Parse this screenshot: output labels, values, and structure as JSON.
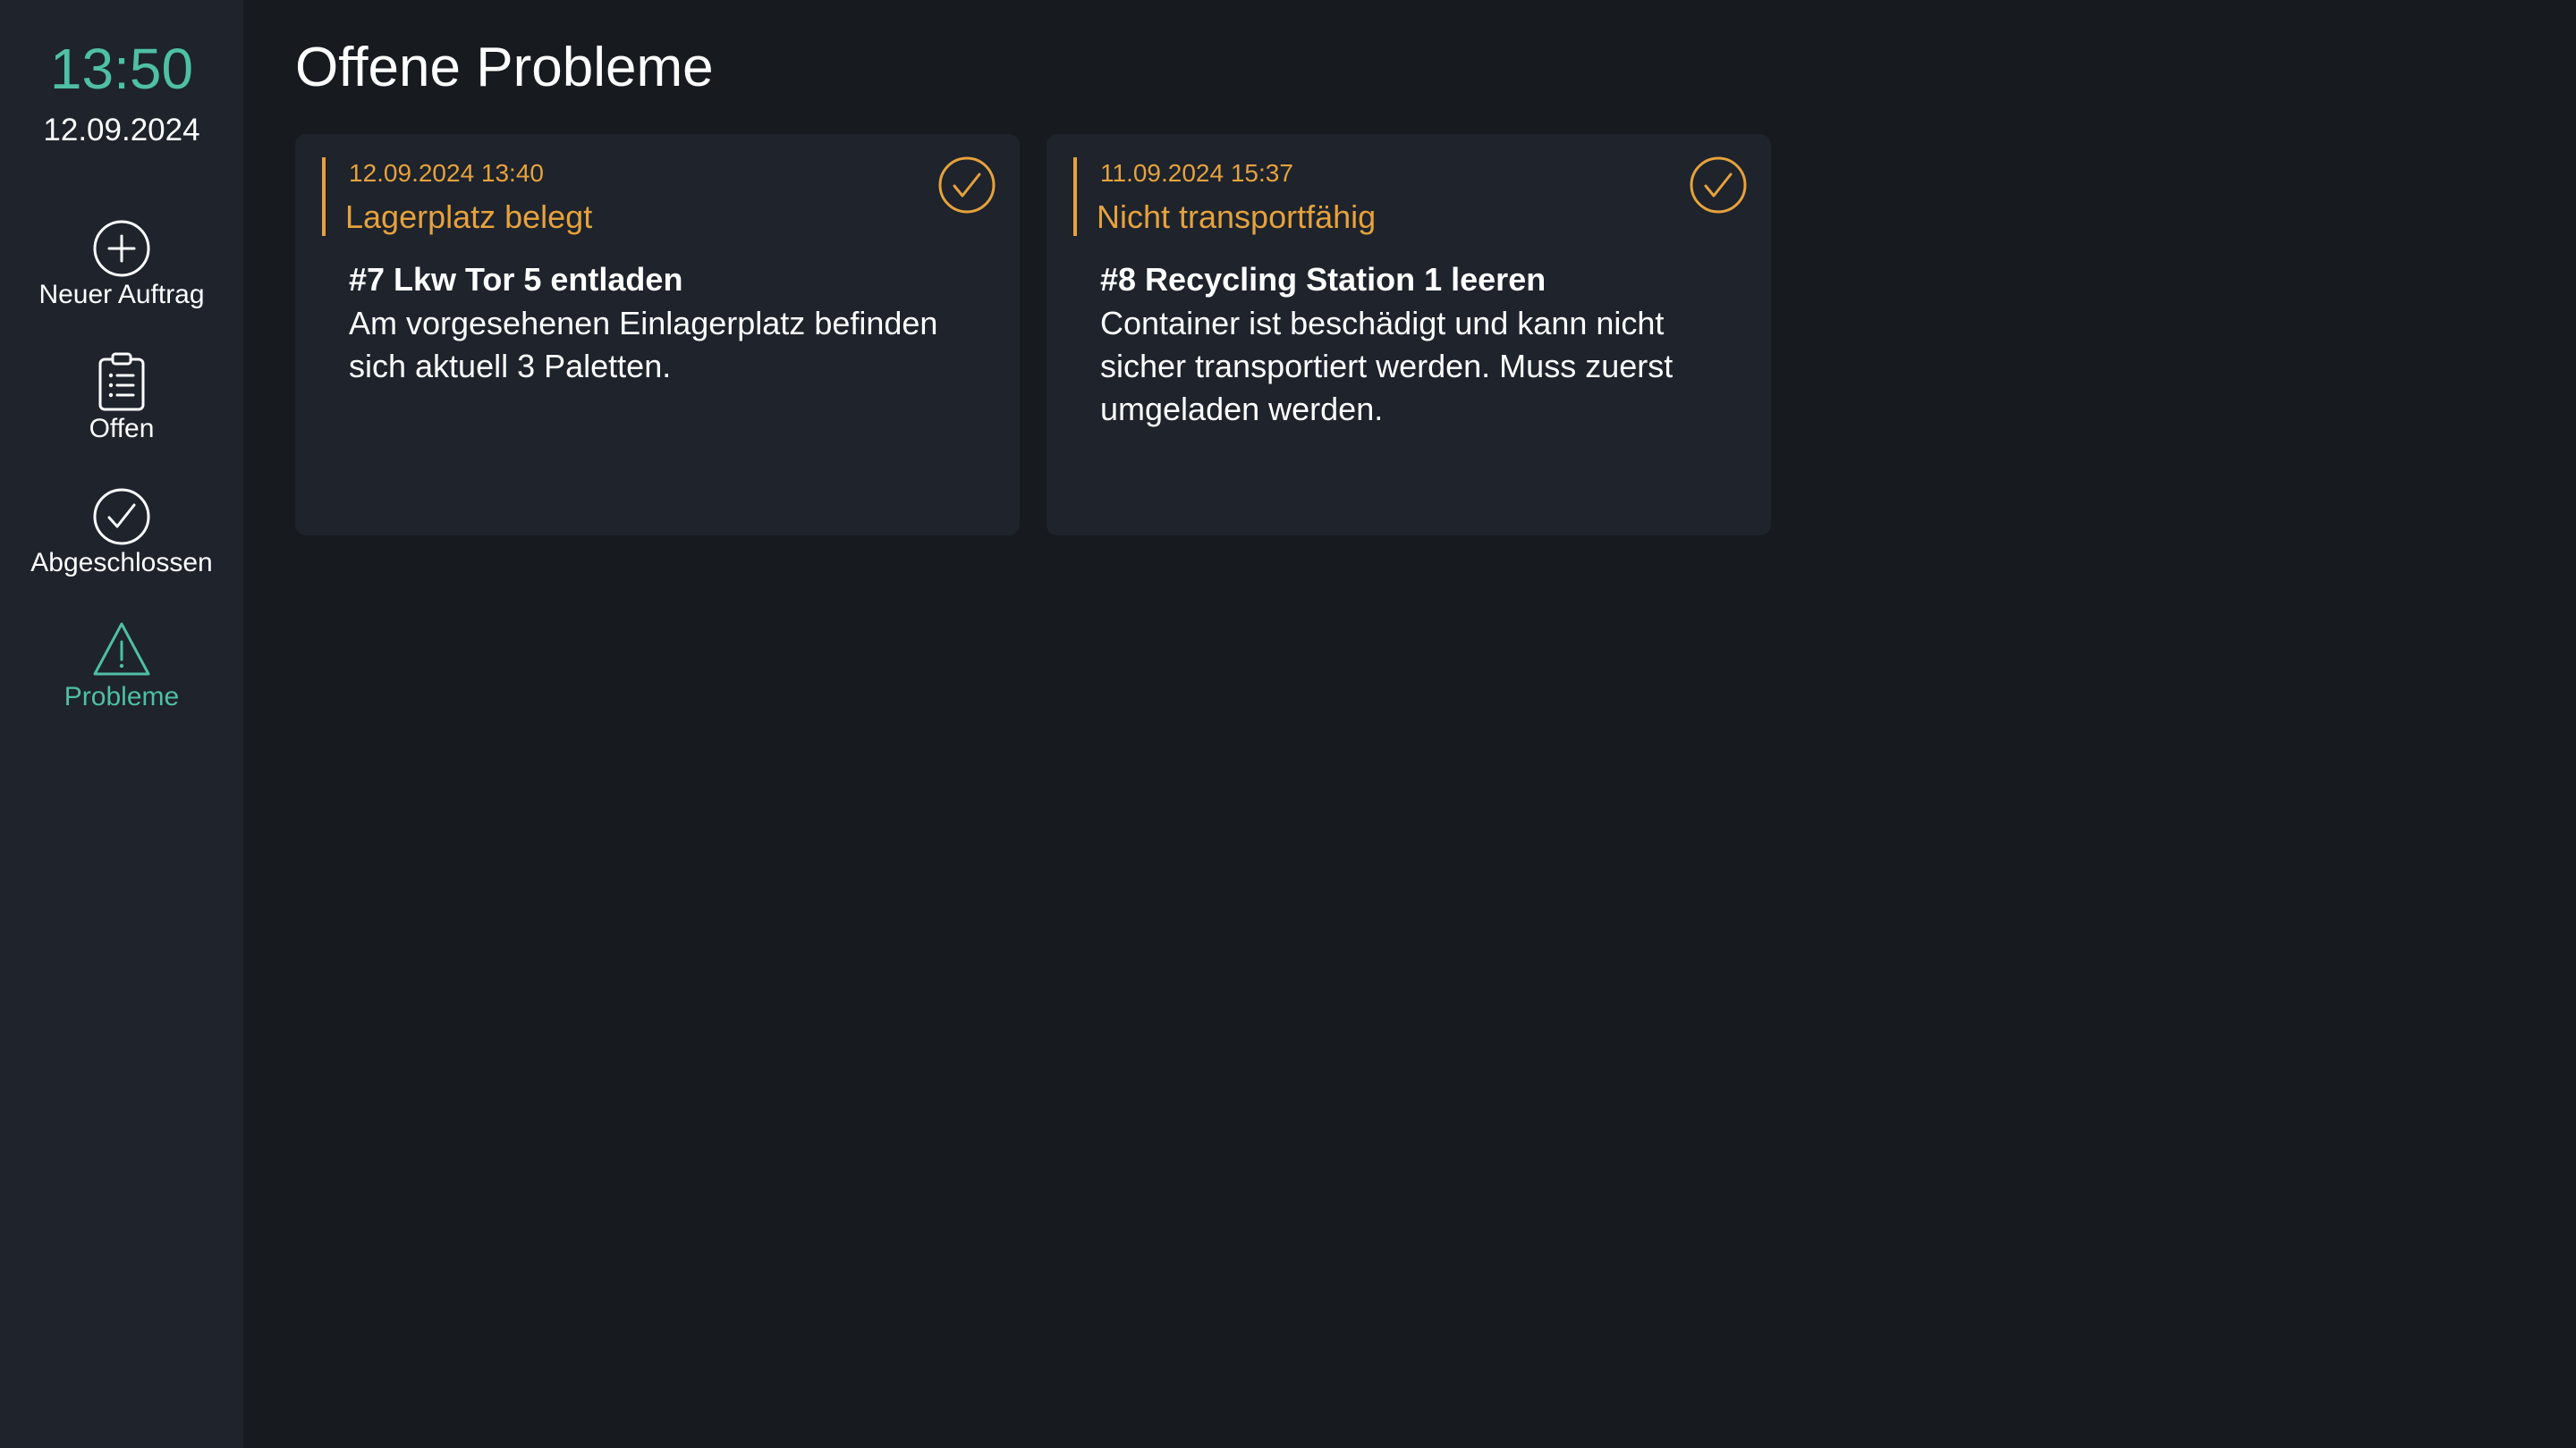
{
  "sidebar": {
    "time": "13:50",
    "date": "12.09.2024",
    "items": [
      {
        "label": "Neuer Auftrag",
        "icon": "plus-circle-icon",
        "active": false
      },
      {
        "label": "Offen",
        "icon": "clipboard-list-icon",
        "active": false
      },
      {
        "label": "Abgeschlossen",
        "icon": "check-circle-icon",
        "active": false
      },
      {
        "label": "Probleme",
        "icon": "warning-triangle-icon",
        "active": true
      }
    ]
  },
  "main": {
    "title": "Offene Probleme",
    "problems": [
      {
        "timestamp": "12.09.2024 13:40",
        "type": "Lagerplatz belegt",
        "order": "#7 Lkw Tor 5 entladen",
        "description": "Am vorgesehenen Einlagerplatz befinden sich aktuell 3 Paletten.",
        "action_icon": "check-circle-icon"
      },
      {
        "timestamp": "11.09.2024 15:37",
        "type": "Nicht transportfähig",
        "order": "#8 Recycling Station 1 leeren",
        "description": "Container ist beschädigt und kann nicht sicher transportiert werden. Muss zuerst umgeladen werden.",
        "action_icon": "check-circle-icon"
      }
    ]
  },
  "colors": {
    "background": "#171a1f",
    "panel": "#1e232c",
    "accent": "#4fbfa5",
    "warning": "#e6a23c",
    "text": "#ffffff"
  }
}
